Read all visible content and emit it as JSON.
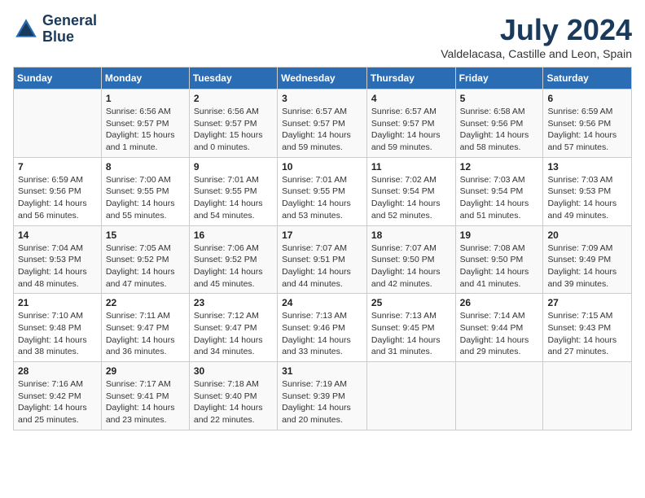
{
  "logo": {
    "line1": "General",
    "line2": "Blue"
  },
  "title": "July 2024",
  "location": "Valdelacasa, Castille and Leon, Spain",
  "days_of_week": [
    "Sunday",
    "Monday",
    "Tuesday",
    "Wednesday",
    "Thursday",
    "Friday",
    "Saturday"
  ],
  "weeks": [
    [
      {
        "day": "",
        "info": ""
      },
      {
        "day": "1",
        "info": "Sunrise: 6:56 AM\nSunset: 9:57 PM\nDaylight: 15 hours\nand 1 minute."
      },
      {
        "day": "2",
        "info": "Sunrise: 6:56 AM\nSunset: 9:57 PM\nDaylight: 15 hours\nand 0 minutes."
      },
      {
        "day": "3",
        "info": "Sunrise: 6:57 AM\nSunset: 9:57 PM\nDaylight: 14 hours\nand 59 minutes."
      },
      {
        "day": "4",
        "info": "Sunrise: 6:57 AM\nSunset: 9:57 PM\nDaylight: 14 hours\nand 59 minutes."
      },
      {
        "day": "5",
        "info": "Sunrise: 6:58 AM\nSunset: 9:56 PM\nDaylight: 14 hours\nand 58 minutes."
      },
      {
        "day": "6",
        "info": "Sunrise: 6:59 AM\nSunset: 9:56 PM\nDaylight: 14 hours\nand 57 minutes."
      }
    ],
    [
      {
        "day": "7",
        "info": "Sunrise: 6:59 AM\nSunset: 9:56 PM\nDaylight: 14 hours\nand 56 minutes."
      },
      {
        "day": "8",
        "info": "Sunrise: 7:00 AM\nSunset: 9:55 PM\nDaylight: 14 hours\nand 55 minutes."
      },
      {
        "day": "9",
        "info": "Sunrise: 7:01 AM\nSunset: 9:55 PM\nDaylight: 14 hours\nand 54 minutes."
      },
      {
        "day": "10",
        "info": "Sunrise: 7:01 AM\nSunset: 9:55 PM\nDaylight: 14 hours\nand 53 minutes."
      },
      {
        "day": "11",
        "info": "Sunrise: 7:02 AM\nSunset: 9:54 PM\nDaylight: 14 hours\nand 52 minutes."
      },
      {
        "day": "12",
        "info": "Sunrise: 7:03 AM\nSunset: 9:54 PM\nDaylight: 14 hours\nand 51 minutes."
      },
      {
        "day": "13",
        "info": "Sunrise: 7:03 AM\nSunset: 9:53 PM\nDaylight: 14 hours\nand 49 minutes."
      }
    ],
    [
      {
        "day": "14",
        "info": "Sunrise: 7:04 AM\nSunset: 9:53 PM\nDaylight: 14 hours\nand 48 minutes."
      },
      {
        "day": "15",
        "info": "Sunrise: 7:05 AM\nSunset: 9:52 PM\nDaylight: 14 hours\nand 47 minutes."
      },
      {
        "day": "16",
        "info": "Sunrise: 7:06 AM\nSunset: 9:52 PM\nDaylight: 14 hours\nand 45 minutes."
      },
      {
        "day": "17",
        "info": "Sunrise: 7:07 AM\nSunset: 9:51 PM\nDaylight: 14 hours\nand 44 minutes."
      },
      {
        "day": "18",
        "info": "Sunrise: 7:07 AM\nSunset: 9:50 PM\nDaylight: 14 hours\nand 42 minutes."
      },
      {
        "day": "19",
        "info": "Sunrise: 7:08 AM\nSunset: 9:50 PM\nDaylight: 14 hours\nand 41 minutes."
      },
      {
        "day": "20",
        "info": "Sunrise: 7:09 AM\nSunset: 9:49 PM\nDaylight: 14 hours\nand 39 minutes."
      }
    ],
    [
      {
        "day": "21",
        "info": "Sunrise: 7:10 AM\nSunset: 9:48 PM\nDaylight: 14 hours\nand 38 minutes."
      },
      {
        "day": "22",
        "info": "Sunrise: 7:11 AM\nSunset: 9:47 PM\nDaylight: 14 hours\nand 36 minutes."
      },
      {
        "day": "23",
        "info": "Sunrise: 7:12 AM\nSunset: 9:47 PM\nDaylight: 14 hours\nand 34 minutes."
      },
      {
        "day": "24",
        "info": "Sunrise: 7:13 AM\nSunset: 9:46 PM\nDaylight: 14 hours\nand 33 minutes."
      },
      {
        "day": "25",
        "info": "Sunrise: 7:13 AM\nSunset: 9:45 PM\nDaylight: 14 hours\nand 31 minutes."
      },
      {
        "day": "26",
        "info": "Sunrise: 7:14 AM\nSunset: 9:44 PM\nDaylight: 14 hours\nand 29 minutes."
      },
      {
        "day": "27",
        "info": "Sunrise: 7:15 AM\nSunset: 9:43 PM\nDaylight: 14 hours\nand 27 minutes."
      }
    ],
    [
      {
        "day": "28",
        "info": "Sunrise: 7:16 AM\nSunset: 9:42 PM\nDaylight: 14 hours\nand 25 minutes."
      },
      {
        "day": "29",
        "info": "Sunrise: 7:17 AM\nSunset: 9:41 PM\nDaylight: 14 hours\nand 23 minutes."
      },
      {
        "day": "30",
        "info": "Sunrise: 7:18 AM\nSunset: 9:40 PM\nDaylight: 14 hours\nand 22 minutes."
      },
      {
        "day": "31",
        "info": "Sunrise: 7:19 AM\nSunset: 9:39 PM\nDaylight: 14 hours\nand 20 minutes."
      },
      {
        "day": "",
        "info": ""
      },
      {
        "day": "",
        "info": ""
      },
      {
        "day": "",
        "info": ""
      }
    ]
  ]
}
